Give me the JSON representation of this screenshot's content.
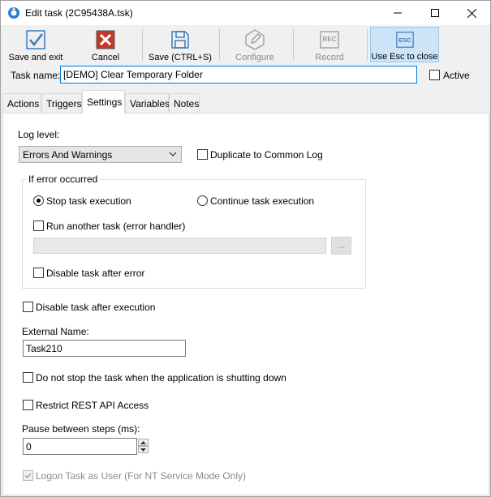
{
  "window": {
    "title": "Edit task (2C95438A.tsk)"
  },
  "toolbar": {
    "save_exit": "Save and exit",
    "cancel": "Cancel",
    "save": "Save (CTRL+S)",
    "configure": "Configure",
    "record": "Record",
    "esc_icon_text": "ESC",
    "esc_close": "Use Esc to close",
    "rec_icon_text": "REC"
  },
  "task_name": {
    "label": "Task name:",
    "value": "[DEMO] Clear Temporary Folder",
    "active_label": "Active",
    "active_checked": false
  },
  "tabs": [
    {
      "label": "Actions"
    },
    {
      "label": "Triggers"
    },
    {
      "label": "Settings"
    },
    {
      "label": "Variables"
    },
    {
      "label": "Notes"
    }
  ],
  "active_tab": "Settings",
  "settings": {
    "log_level_label": "Log level:",
    "log_level_value": "Errors And Warnings",
    "duplicate_log_label": "Duplicate to Common Log",
    "error_group_title": "If error occurred",
    "stop_execution_label": "Stop task execution",
    "continue_execution_label": "Continue task execution",
    "run_another_label": "Run another task (error handler)",
    "browse_button": "...",
    "disable_after_error_label": "Disable task after error",
    "disable_after_execution_label": "Disable task after execution",
    "external_name_label": "External Name:",
    "external_name_value": "Task210",
    "dont_stop_label": "Do not stop the task when the application is shutting down",
    "restrict_rest_label": "Restrict REST API Access",
    "pause_label": "Pause between steps (ms):",
    "pause_value": "0",
    "logon_label": "Logon Task as User (For NT Service Mode Only)"
  },
  "colors": {
    "accent": "#0078d7",
    "save_icon": "#3a7bbf",
    "cancel_icon": "#c0392b",
    "active_button_bg": "#cce4f7"
  }
}
